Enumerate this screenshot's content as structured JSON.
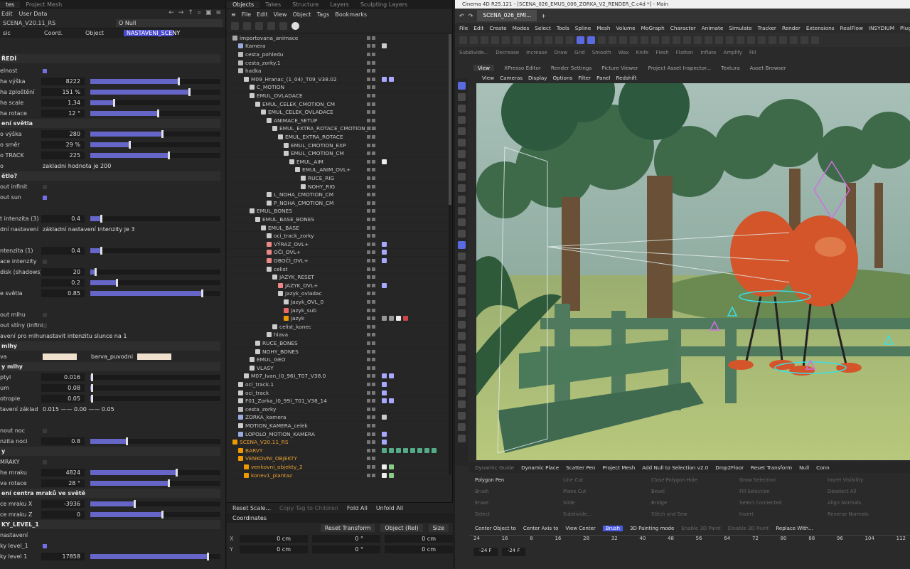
{
  "attr": {
    "tabs": [
      "tes",
      "Project Mesh"
    ],
    "menu": [
      "Edit",
      "User Data"
    ],
    "object_label": "SCENA_V20.11_RS",
    "object_field": "O Null",
    "subtabs": [
      "sic",
      "Coord.",
      "Object",
      "NASTAVENI_SCENY"
    ],
    "section_top": "ŘEDÍ",
    "rows": [
      {
        "label": "elnost",
        "type": "check",
        "on": true
      },
      {
        "label": "ha výška",
        "value": "8222",
        "fill": 0.68
      },
      {
        "label": "ha zploštění",
        "value": "151 %",
        "fill": 0.76
      },
      {
        "label": "ha scale",
        "value": "1,34",
        "fill": 0.18
      },
      {
        "label": "ha rotace",
        "value": "12 °",
        "fill": 0.52
      },
      {
        "section": "ení světla"
      },
      {
        "label": "o výška",
        "value": "280",
        "fill": 0.55
      },
      {
        "label": "o směr",
        "value": "29 %",
        "fill": 0.3
      },
      {
        "label": "o TRACK",
        "value": "225",
        "fill": 0.6
      },
      {
        "label": "o",
        "type": "text",
        "text": "zakladni hodnota je 200"
      },
      {
        "section": "ětlo?"
      },
      {
        "label": "out infinit",
        "type": "check",
        "on": false
      },
      {
        "label": "out sun",
        "type": "check",
        "on": true
      },
      {
        "label": "",
        "type": "blank"
      },
      {
        "label": "t intenzita (3)",
        "value": "0.4",
        "fill": 0.08
      },
      {
        "label": "dní nastavení",
        "type": "text",
        "text": "základní nastavení intenzity je 3"
      },
      {
        "label": "",
        "type": "blank"
      },
      {
        "label": "ntenzita (1)",
        "value": "0.4",
        "fill": 0.08
      },
      {
        "label": "ace intenzity",
        "type": "check",
        "on": false
      },
      {
        "label": "disk (shadows)",
        "value": "20",
        "fill": 0.04
      },
      {
        "label": "",
        "value": "0.2",
        "fill": 0.2
      },
      {
        "label": "e světla",
        "value": "0.85",
        "fill": 0.86
      },
      {
        "label": "",
        "type": "blank"
      },
      {
        "label": "out mlhu",
        "type": "check",
        "on": false
      },
      {
        "label": "out stíny (infinit)",
        "type": "check",
        "on": false
      },
      {
        "label": "avení pro mlhu",
        "type": "text",
        "text": "nastavit intenzitu slunce na 1"
      },
      {
        "section": "mlhy"
      },
      {
        "label": "va",
        "type": "swatch",
        "text": "barva_puvodni"
      },
      {
        "section": "y mlhy"
      },
      {
        "label": "ptyl",
        "value": "0.016",
        "fill": 0.01
      },
      {
        "label": "um",
        "value": "0.08",
        "fill": 0.01
      },
      {
        "label": "otropie",
        "value": "0.05",
        "fill": 0.01
      },
      {
        "label": "tavení základ",
        "type": "text",
        "text": "0.015 —— 0.00 —— 0.05"
      },
      {
        "label": "",
        "type": "blank"
      },
      {
        "label": "nout noc",
        "type": "check",
        "on": false
      },
      {
        "label": "nzita noci",
        "value": "0.8",
        "fill": 0.28
      },
      {
        "section": "y"
      },
      {
        "label": "MRAKY",
        "type": "check",
        "on": false
      },
      {
        "label": "ha mraku",
        "value": "4824",
        "fill": 0.66
      },
      {
        "label": "va rotace",
        "value": "28 °",
        "fill": 0.6
      },
      {
        "section": "ení centra mraků ve světě"
      },
      {
        "label": "ce mraku X",
        "value": "-3936",
        "fill": 0.34
      },
      {
        "label": "ce mraku Z",
        "value": "0",
        "fill": 0.55
      },
      {
        "section": "KY_LEVEL_1"
      },
      {
        "label": "nastavení",
        "type": "sub"
      },
      {
        "label": "ky level_1",
        "type": "check",
        "on": true
      },
      {
        "label": "ky level 1",
        "value": "17858",
        "fill": 0.9
      }
    ]
  },
  "objm": {
    "tabs": [
      "Objects",
      "Takes",
      "Structure",
      "Layers",
      "Sculpting Layers"
    ],
    "menu": [
      "File",
      "Edit",
      "View",
      "Object",
      "Tags",
      "Bookmarks"
    ],
    "items": [
      {
        "name": "importovana_animace",
        "indent": 0,
        "icon": "#aaa",
        "tags": []
      },
      {
        "name": "Kamera",
        "indent": 1,
        "icon": "#9ad",
        "tags": [
          "#ccc"
        ]
      },
      {
        "name": "cesta_pohledu",
        "indent": 1,
        "icon": "#bbb",
        "tags": []
      },
      {
        "name": "cesta_zorky.1",
        "indent": 1,
        "icon": "#bbb",
        "tags": []
      },
      {
        "name": "hadka",
        "indent": 1,
        "icon": "#bbb",
        "tags": []
      },
      {
        "name": "M09_Hranac_(1_04)_T09_V38.02",
        "indent": 2,
        "icon": "#ccc",
        "tags": [
          "#a8a8ff",
          "#a8a8ff"
        ]
      },
      {
        "name": "C_MOTION",
        "indent": 3,
        "icon": "#ccc",
        "tags": []
      },
      {
        "name": "EMUL_OVLADACE",
        "indent": 3,
        "icon": "#ccc",
        "tags": []
      },
      {
        "name": "EMUL_CELEK_CMOTION_CM",
        "indent": 4,
        "icon": "#ccc",
        "tags": []
      },
      {
        "name": "EMUL_CELEK_OVLADACE",
        "indent": 5,
        "icon": "#ccc",
        "tags": []
      },
      {
        "name": "ANIMACE_SETUP",
        "indent": 6,
        "icon": "#ccc",
        "tags": []
      },
      {
        "name": "EMUL_EXTRA_ROTACE_CMOTION_CM",
        "indent": 7,
        "icon": "#ccc",
        "tags": []
      },
      {
        "name": "EMUL_EXTRA_ROTACE",
        "indent": 8,
        "icon": "#ccc",
        "tags": []
      },
      {
        "name": "EMUL_CMOTION_EXP",
        "indent": 9,
        "icon": "#ccc",
        "tags": []
      },
      {
        "name": "EMUL_CMOTION_CM",
        "indent": 9,
        "icon": "#ccc",
        "tags": []
      },
      {
        "name": "EMUL_AIM",
        "indent": 10,
        "icon": "#ccc",
        "tags": [
          "#eee"
        ]
      },
      {
        "name": "EMUL_ANIM_OVL+",
        "indent": 11,
        "icon": "#ccc",
        "tags": []
      },
      {
        "name": "RUCE_RIG",
        "indent": 12,
        "icon": "#ccc",
        "tags": []
      },
      {
        "name": "NOHY_RIG",
        "indent": 12,
        "icon": "#ccc",
        "tags": []
      },
      {
        "name": "L_NOHA_CMOTION_CM",
        "indent": 6,
        "icon": "#ccc",
        "tags": []
      },
      {
        "name": "P_NOHA_CMOTION_CM",
        "indent": 6,
        "icon": "#ccc",
        "tags": []
      },
      {
        "name": "EMUL_BONES",
        "indent": 3,
        "icon": "#ccc",
        "tags": []
      },
      {
        "name": "EMUL_BASE_BONES",
        "indent": 4,
        "icon": "#ccc",
        "tags": []
      },
      {
        "name": "EMUL_BASE",
        "indent": 5,
        "icon": "#ccc",
        "tags": []
      },
      {
        "name": "oci_track_zorky",
        "indent": 6,
        "icon": "#ccc",
        "tags": []
      },
      {
        "name": "VÝRAZ_OVL+",
        "indent": 6,
        "icon": "#e88",
        "tags": [
          "#a8a8ff"
        ]
      },
      {
        "name": "OČI_OVL+",
        "indent": 6,
        "icon": "#e88",
        "tags": [
          "#a8a8ff"
        ]
      },
      {
        "name": "OBOČÍ_OVL+",
        "indent": 6,
        "icon": "#e88",
        "tags": [
          "#a8a8ff"
        ]
      },
      {
        "name": "celist",
        "indent": 6,
        "icon": "#ccc",
        "tags": []
      },
      {
        "name": "JAZYK_RESET",
        "indent": 7,
        "icon": "#ccc",
        "tags": []
      },
      {
        "name": "JAZYK_OVL+",
        "indent": 8,
        "icon": "#e88",
        "tags": [
          "#a8a8ff"
        ]
      },
      {
        "name": "Jazyk_ovladac",
        "indent": 8,
        "icon": "#ccc",
        "tags": []
      },
      {
        "name": "Jazyk_OVL_0",
        "indent": 9,
        "icon": "#ccc",
        "tags": []
      },
      {
        "name": "jazyk_sub",
        "indent": 9,
        "icon": "#e66",
        "tags": []
      },
      {
        "name": "jazyk",
        "indent": 9,
        "icon": "#e90",
        "tags": [
          "#999",
          "#999",
          "#eee",
          "#c44"
        ]
      },
      {
        "name": "celist_konec",
        "indent": 7,
        "icon": "#ccc",
        "tags": []
      },
      {
        "name": "hlava",
        "indent": 6,
        "icon": "#ccc",
        "tags": []
      },
      {
        "name": "RUCE_BONES",
        "indent": 4,
        "icon": "#ccc",
        "tags": []
      },
      {
        "name": "NOHY_BONES",
        "indent": 4,
        "icon": "#ccc",
        "tags": []
      },
      {
        "name": "EMUL_GEO",
        "indent": 3,
        "icon": "#ccc",
        "tags": []
      },
      {
        "name": "VLASY",
        "indent": 3,
        "icon": "#ccc",
        "tags": []
      },
      {
        "name": "M07_Ivan_(0_96)_T07_V38.0",
        "indent": 2,
        "icon": "#ccc",
        "tags": [
          "#a8a8ff",
          "#a8a8ff"
        ]
      },
      {
        "name": "oci_track.1",
        "indent": 1,
        "icon": "#ccc",
        "tags": [
          "#a8a8ff"
        ]
      },
      {
        "name": "oci_track",
        "indent": 1,
        "icon": "#ccc",
        "tags": [
          "#a8a8ff"
        ]
      },
      {
        "name": "F01_Zorka_(0_99)_T01_V38_14",
        "indent": 1,
        "icon": "#ccc",
        "tags": [
          "#a8a8ff",
          "#a8a8ff"
        ]
      },
      {
        "name": "cesta_zorky",
        "indent": 1,
        "icon": "#bbb",
        "tags": []
      },
      {
        "name": "ZORKA_kamera",
        "indent": 1,
        "icon": "#9ad",
        "tags": [
          "#ccc"
        ]
      },
      {
        "name": "MOTION_KAMERA_celek",
        "indent": 1,
        "icon": "#ccc",
        "tags": []
      },
      {
        "name": "LOPOLO_MOTION_KAMERA",
        "indent": 1,
        "icon": "#9ad",
        "tags": [
          "#a8a8ff"
        ]
      },
      {
        "name": "SCENA_V20.11_RS",
        "indent": 0,
        "icon": "#e90",
        "tags": [
          "#a8a8ff"
        ],
        "orange": true
      },
      {
        "name": "BARVY",
        "indent": 1,
        "icon": "#e90",
        "tags": [
          "#5a8",
          "#5a8",
          "#5a8",
          "#5a8",
          "#5a8",
          "#5a8",
          "#5a8",
          "#5a8"
        ],
        "orange": true
      },
      {
        "name": "VENKOVNI_OBJEKTY",
        "indent": 1,
        "icon": "#e90",
        "tags": [],
        "orange": true
      },
      {
        "name": "venkovni_objekty_2",
        "indent": 2,
        "icon": "#e90",
        "tags": [
          "#eee",
          "#8c8"
        ],
        "orange": true
      },
      {
        "name": "konev1_plantaz",
        "indent": 2,
        "icon": "#e90",
        "tags": [
          "#eee",
          "#8c8"
        ],
        "orange": true
      }
    ],
    "bottom": {
      "reset": "Reset Scale...",
      "copytag": "Copy Tag to Children",
      "fold": "Fold All",
      "unfold": "Unfold All"
    },
    "coord": {
      "title": "Coordinates",
      "reset": "Reset Transform",
      "mode": "Object (Rel)",
      "size": "Size",
      "rows": [
        {
          "axis": "X",
          "a": "0 cm",
          "b": "0 °",
          "c": "0 cm"
        },
        {
          "axis": "Y",
          "a": "0 cm",
          "b": "0 °",
          "c": "0 cm"
        }
      ]
    }
  },
  "c4d": {
    "title": "Cinema 4D R25.121 - [SCENA_026_EMUS_006_ZORKA_V2_RENDER_C.c4d *] - Main",
    "doc_tab": "SCENA_026_EMI...",
    "menu": [
      "File",
      "Edit",
      "Create",
      "Modes",
      "Select",
      "Tools",
      "Spline",
      "Mesh",
      "Volume",
      "MoGraph",
      "Character",
      "Animate",
      "Simulate",
      "Tracker",
      "Render",
      "Extensions",
      "RealFlow",
      "INSYDIUM",
      "Plugins 4D"
    ],
    "tb2": [
      "Subdivide...",
      "Decrease",
      "Increase",
      "Draw",
      "Grid",
      "Smooth",
      "Wax",
      "Knife",
      "Flesh",
      "Flatten",
      "Inflate",
      "Amplify",
      "Fill"
    ],
    "panel_tabs": [
      "View",
      "XPresso Editor",
      "Render Settings",
      "Picture Viewer",
      "Project Asset Inspector...",
      "Textura",
      "Asset Browser"
    ],
    "vp_menu": [
      "View",
      "Cameras",
      "Display",
      "Options",
      "Filter",
      "Panel",
      "Redshift"
    ],
    "strip": [
      "Dynamic Guide",
      "Dynamic Place",
      "Scatter Pen",
      "Project Mesh",
      "Add Null to Selection v2.0",
      "Drop2Floor",
      "Reset Transform",
      "Null",
      "Conn"
    ],
    "cmds": [
      {
        "t": "Polygon Pen",
        "on": true
      },
      {
        "t": "Line Cut"
      },
      {
        "t": "Close Polygon Hole"
      },
      {
        "t": "Grow Selection"
      },
      {
        "t": "Insert Visibility"
      },
      {
        "t": "Brush"
      },
      {
        "t": "Plane Cut"
      },
      {
        "t": "Bevel"
      },
      {
        "t": "Fill Selection"
      },
      {
        "t": "Deselect All"
      },
      {
        "t": "Erase"
      },
      {
        "t": "Slide"
      },
      {
        "t": "Bridge"
      },
      {
        "t": "Select Connected"
      },
      {
        "t": "Align Normals"
      },
      {
        "t": "Select"
      },
      {
        "t": "Subdivide..."
      },
      {
        "t": "Stitch and Sew"
      },
      {
        "t": "Invert"
      },
      {
        "t": "Reverse Normals"
      }
    ],
    "cmds_right": [
      "Grow Selection",
      "Shrink Selection",
      "Hide Selection",
      "Show All"
    ],
    "hb": [
      "HB_Convert",
      "HB_SmoothEdgeCancel",
      "HB_SetPhong",
      "Break Phong Shading"
    ],
    "bottom": [
      "Center Object to",
      "Center Axis to",
      "View Center",
      "Brush",
      "3D Painting mode",
      "Enable 3D Paint",
      "Disable 3D Paint",
      "Replace With..."
    ],
    "ticks": [
      "24",
      "16",
      "8",
      "16",
      "28",
      "32",
      "40",
      "48",
      "56",
      "64",
      "72",
      "80",
      "88",
      "96",
      "104",
      "112"
    ],
    "frames": [
      "-24 F",
      "-24 F"
    ]
  }
}
